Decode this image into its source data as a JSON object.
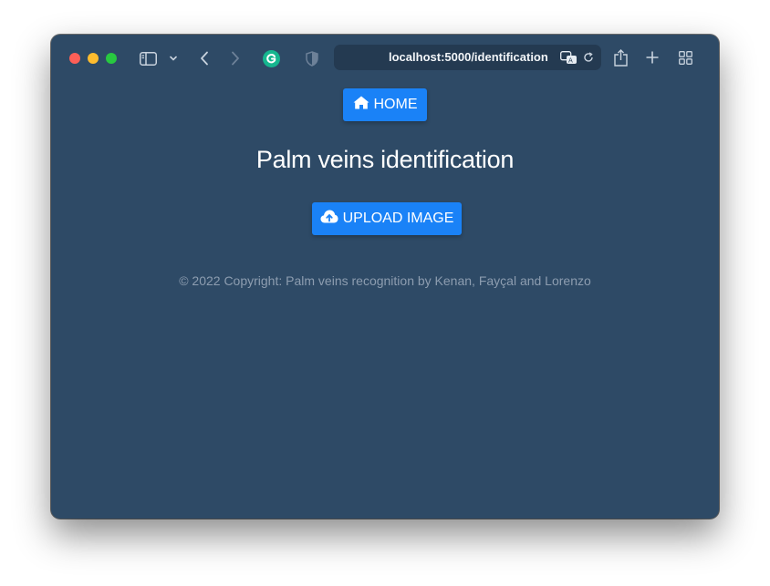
{
  "browser": {
    "url": "localhost:5000/identification",
    "colors": {
      "close": "#fe5f57",
      "minimize": "#febc2e",
      "maximize": "#28c840",
      "grammarly": "#16b68f"
    }
  },
  "page": {
    "background": "#2e4a66",
    "home_label": "HOME",
    "home_icon": "home-icon",
    "title": "Palm veins identification",
    "upload_label": "UPLOAD IMAGE",
    "upload_icon": "cloud-upload-icon",
    "footer": "© 2022 Copyright: Palm veins recognition by Kenan, Fayçal and Lorenzo",
    "accent": "#1a82f7"
  }
}
